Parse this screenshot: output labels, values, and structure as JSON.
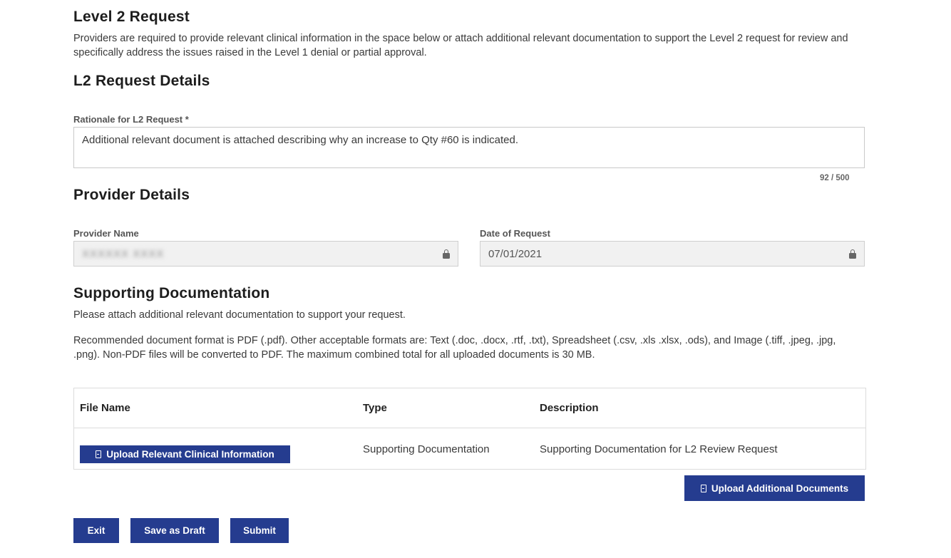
{
  "level2": {
    "title": "Level 2 Request",
    "description": "Providers are required to provide relevant clinical information in the space below or attach additional relevant documentation to support the Level 2 request for review and specifically address the issues raised in the Level 1 denial or partial approval."
  },
  "request_details": {
    "title": "L2 Request Details",
    "rationale_label": "Rationale for L2 Request *",
    "rationale_value": "Additional relevant document is attached describing why an increase to Qty #60 is indicated.",
    "char_counter": "92 / 500"
  },
  "provider_details": {
    "title": "Provider Details",
    "provider_name_label": "Provider Name",
    "provider_name_value": "XXXXXX XXXX",
    "date_label": "Date of Request",
    "date_value": "07/01/2021"
  },
  "supporting_docs": {
    "title": "Supporting Documentation",
    "intro": "Please attach additional relevant documentation to support your request.",
    "formats": "Recommended document format is PDF (.pdf). Other acceptable formats are: Text (.doc, .docx, .rtf, .txt), Spreadsheet (.csv, .xls .xlsx, .ods), and Image (.tiff, .jpeg, .jpg, .png). Non-PDF files will be converted to PDF. The maximum combined total for all uploaded documents is 30 MB.",
    "columns": [
      "File Name",
      "Type",
      "Description"
    ],
    "row": {
      "upload_label": "Upload Relevant Clinical Information",
      "type": "Supporting Documentation",
      "description": "Supporting Documentation for L2 Review Request"
    },
    "upload_additional_label": "Upload Additional Documents"
  },
  "actions": {
    "exit": "Exit",
    "save_draft": "Save as Draft",
    "submit": "Submit"
  },
  "colors": {
    "primary": "#253c8f"
  }
}
